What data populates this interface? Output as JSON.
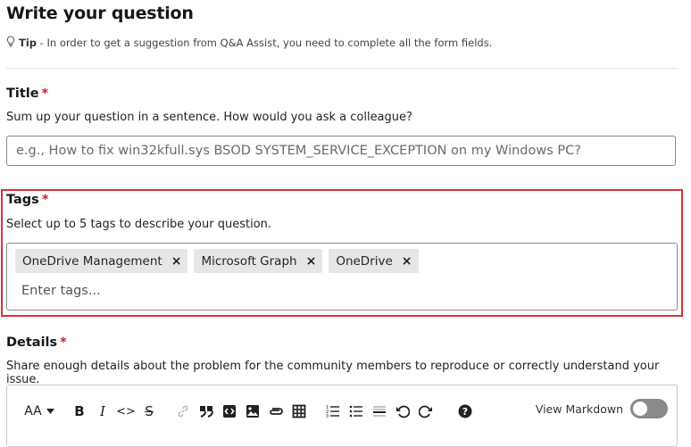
{
  "header": {
    "title": "Write your question",
    "tip_label": "Tip",
    "tip_text": " - In order to get a suggestion from Q&A Assist, you need to complete all the form fields."
  },
  "title_field": {
    "label": "Title",
    "required_mark": "*",
    "help": "Sum up your question in a sentence. How would you ask a colleague?",
    "placeholder": "e.g., How to fix win32kfull.sys BSOD SYSTEM_SERVICE_EXCEPTION on my Windows PC?"
  },
  "tags_field": {
    "label": "Tags",
    "required_mark": "*",
    "help": "Select up to 5 tags to describe your question.",
    "chips": [
      {
        "label": "OneDrive Management",
        "remove": "×"
      },
      {
        "label": "Microsoft Graph",
        "remove": "×"
      },
      {
        "label": "OneDrive",
        "remove": "×"
      }
    ],
    "placeholder": "Enter tags..."
  },
  "details_field": {
    "label": "Details",
    "required_mark": "*",
    "help": "Share enough details about the problem for the community members to reproduce or correctly understand your issue."
  },
  "editor_toolbar": {
    "font_size": "AA",
    "bold": "B",
    "italic": "I",
    "code": "<>",
    "strike": "S",
    "view_markdown_label": "View Markdown",
    "view_markdown_on": false,
    "icons": [
      "chevron-down-icon",
      "link-icon",
      "quote-icon",
      "code-block-icon",
      "image-icon",
      "attachment-icon",
      "table-icon",
      "ordered-list-icon",
      "unordered-list-icon",
      "horizontal-rule-icon",
      "undo-icon",
      "redo-icon",
      "help-icon",
      "lightbulb-icon"
    ]
  }
}
